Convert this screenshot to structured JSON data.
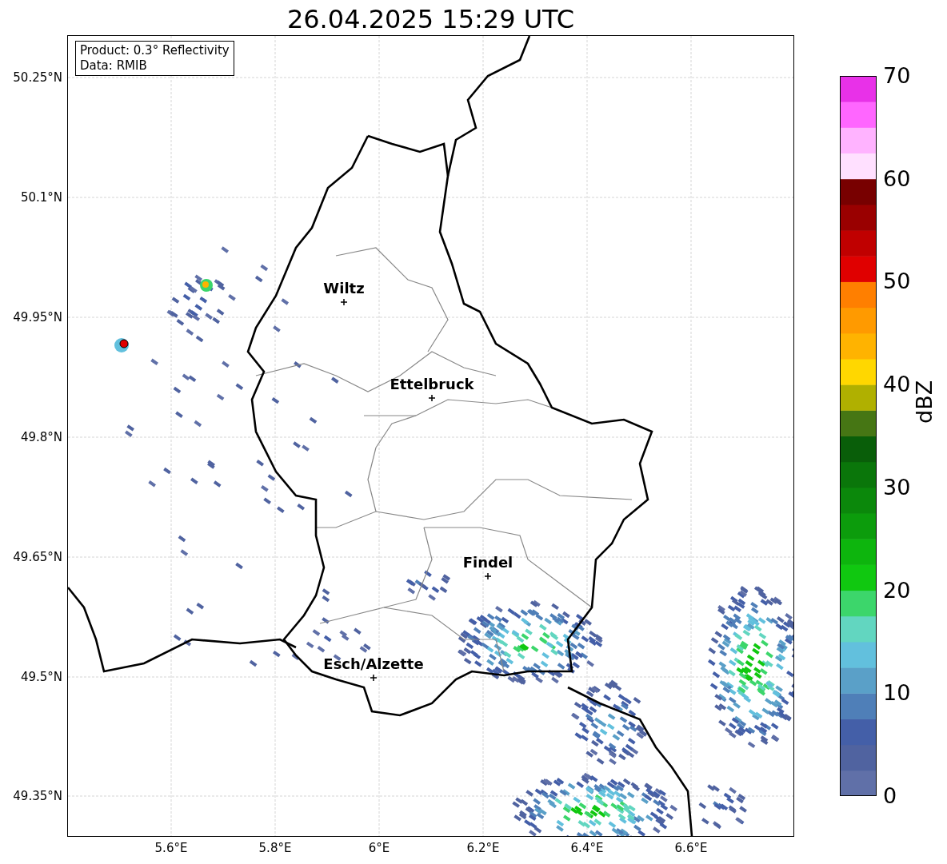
{
  "title": "26.04.2025 15:29 UTC",
  "info_box": {
    "lines": [
      "Product: 0.3° Reflectivity",
      "Data: RMIB"
    ]
  },
  "cities": [
    {
      "name": "Wiltz"
    },
    {
      "name": "Ettelbruck"
    },
    {
      "name": "Findel"
    },
    {
      "name": "Esch/Alzette"
    }
  ],
  "x_ticks": [
    "5.6°E",
    "5.8°E",
    "6°E",
    "6.2°E",
    "6.4°E",
    "6.6°E"
  ],
  "y_ticks": [
    "50.25°N",
    "50.1°N",
    "49.95°N",
    "49.8°N",
    "49.65°N",
    "49.5°N",
    "49.35°N"
  ],
  "colorbar": {
    "label": "dBZ",
    "ticks": [
      "70",
      "60",
      "50",
      "40",
      "30",
      "20",
      "10",
      "0"
    ],
    "bands": [
      {
        "color": "#6070a8"
      },
      {
        "color": "#5063a0"
      },
      {
        "color": "#445fa8"
      },
      {
        "color": "#4f7fb8"
      },
      {
        "color": "#5aa0c8"
      },
      {
        "color": "#62c0dd"
      },
      {
        "color": "#62d6c0"
      },
      {
        "color": "#3cd66b"
      },
      {
        "color": "#10c810"
      },
      {
        "color": "#0db50d"
      },
      {
        "color": "#0c9c0c"
      },
      {
        "color": "#0b880b"
      },
      {
        "color": "#0a760a"
      },
      {
        "color": "#095e09"
      },
      {
        "color": "#467614"
      },
      {
        "color": "#b0b000"
      },
      {
        "color": "#ffd700"
      },
      {
        "color": "#ffb300"
      },
      {
        "color": "#ff9a00"
      },
      {
        "color": "#ff7f00"
      },
      {
        "color": "#e00000"
      },
      {
        "color": "#c00000"
      },
      {
        "color": "#9a0000"
      },
      {
        "color": "#780000"
      },
      {
        "color": "#ffe0ff"
      },
      {
        "color": "#ffb3ff"
      },
      {
        "color": "#ff66ff"
      },
      {
        "color": "#e831e8"
      }
    ]
  }
}
